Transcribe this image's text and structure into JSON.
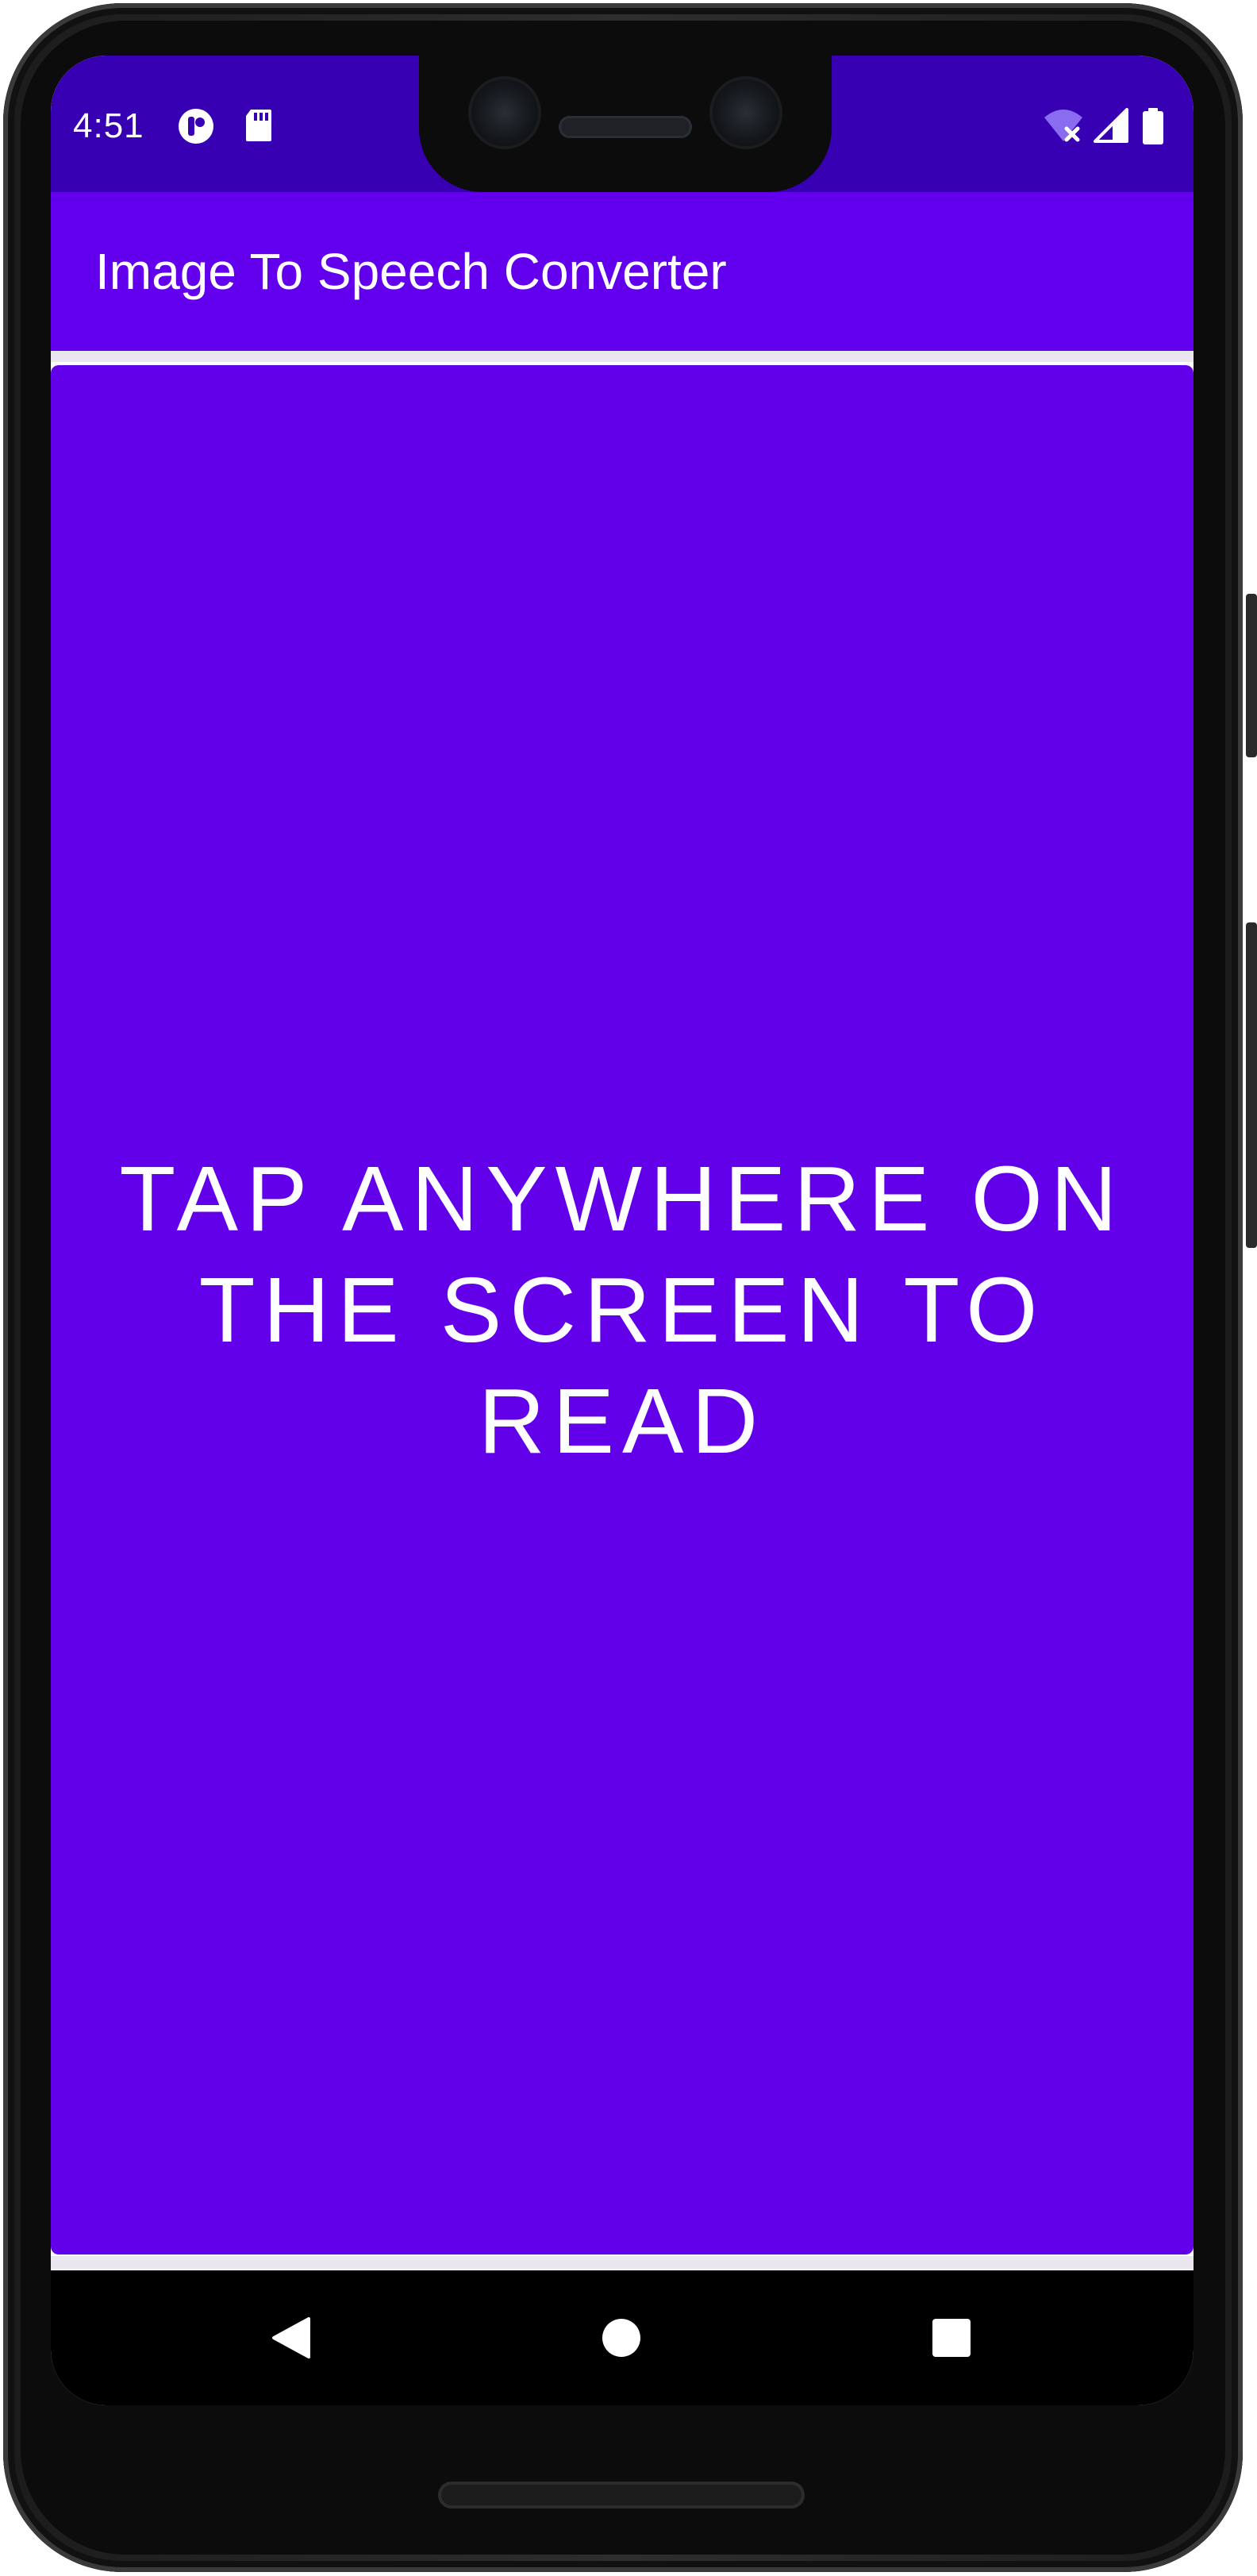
{
  "status_bar": {
    "time": "4:51",
    "left_icons": [
      "app-notification-icon",
      "sd-card-icon"
    ],
    "right_icons": [
      "wifi-off-icon",
      "cell-signal-icon",
      "battery-icon"
    ],
    "background_color": "#3700b3"
  },
  "app_bar": {
    "title": "Image To Speech Converter",
    "background_color": "#6200ee"
  },
  "main": {
    "instruction": "TAP ANYWHERE ON THE SCREEN TO READ",
    "background_color": "#6200ea"
  },
  "nav_bar": {
    "buttons": [
      "back-icon",
      "home-icon",
      "recents-icon"
    ]
  }
}
